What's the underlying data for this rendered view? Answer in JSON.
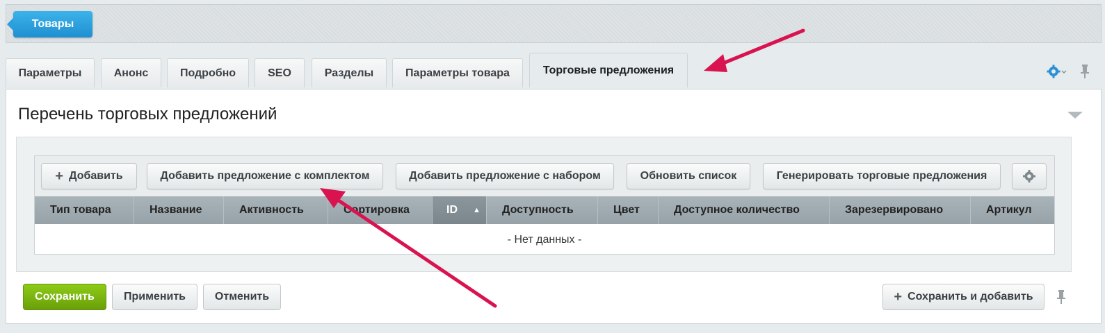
{
  "breadcrumb": {
    "label": "Товары"
  },
  "tabs": [
    {
      "label": "Параметры"
    },
    {
      "label": "Анонс"
    },
    {
      "label": "Подробно"
    },
    {
      "label": "SEO"
    },
    {
      "label": "Разделы"
    },
    {
      "label": "Параметры товара"
    },
    {
      "label": "Торговые предложения",
      "active": true
    }
  ],
  "panel": {
    "title": "Перечень торговых предложений"
  },
  "toolbar": {
    "add": "Добавить",
    "add_kit": "Добавить предложение с комплектом",
    "add_set": "Добавить предложение с набором",
    "refresh": "Обновить список",
    "generate": "Генерировать торговые предложения"
  },
  "columns": [
    "Тип товара",
    "Название",
    "Активность",
    "Сортировка",
    "ID",
    "Доступность",
    "Цвет",
    "Доступное количество",
    "Зарезервировано",
    "Артикул"
  ],
  "empty_text": "- Нет данных -",
  "footer": {
    "save": "Сохранить",
    "apply": "Применить",
    "cancel": "Отменить",
    "save_and_add": "Сохранить и добавить"
  },
  "colors": {
    "accent": "#1f8fd0",
    "save": "#6aa00a",
    "annotation_arrow": "#d9134f"
  },
  "icons": [
    "gear-icon",
    "pin-icon",
    "plus-icon",
    "chevron-down-icon",
    "sort-asc-icon"
  ]
}
